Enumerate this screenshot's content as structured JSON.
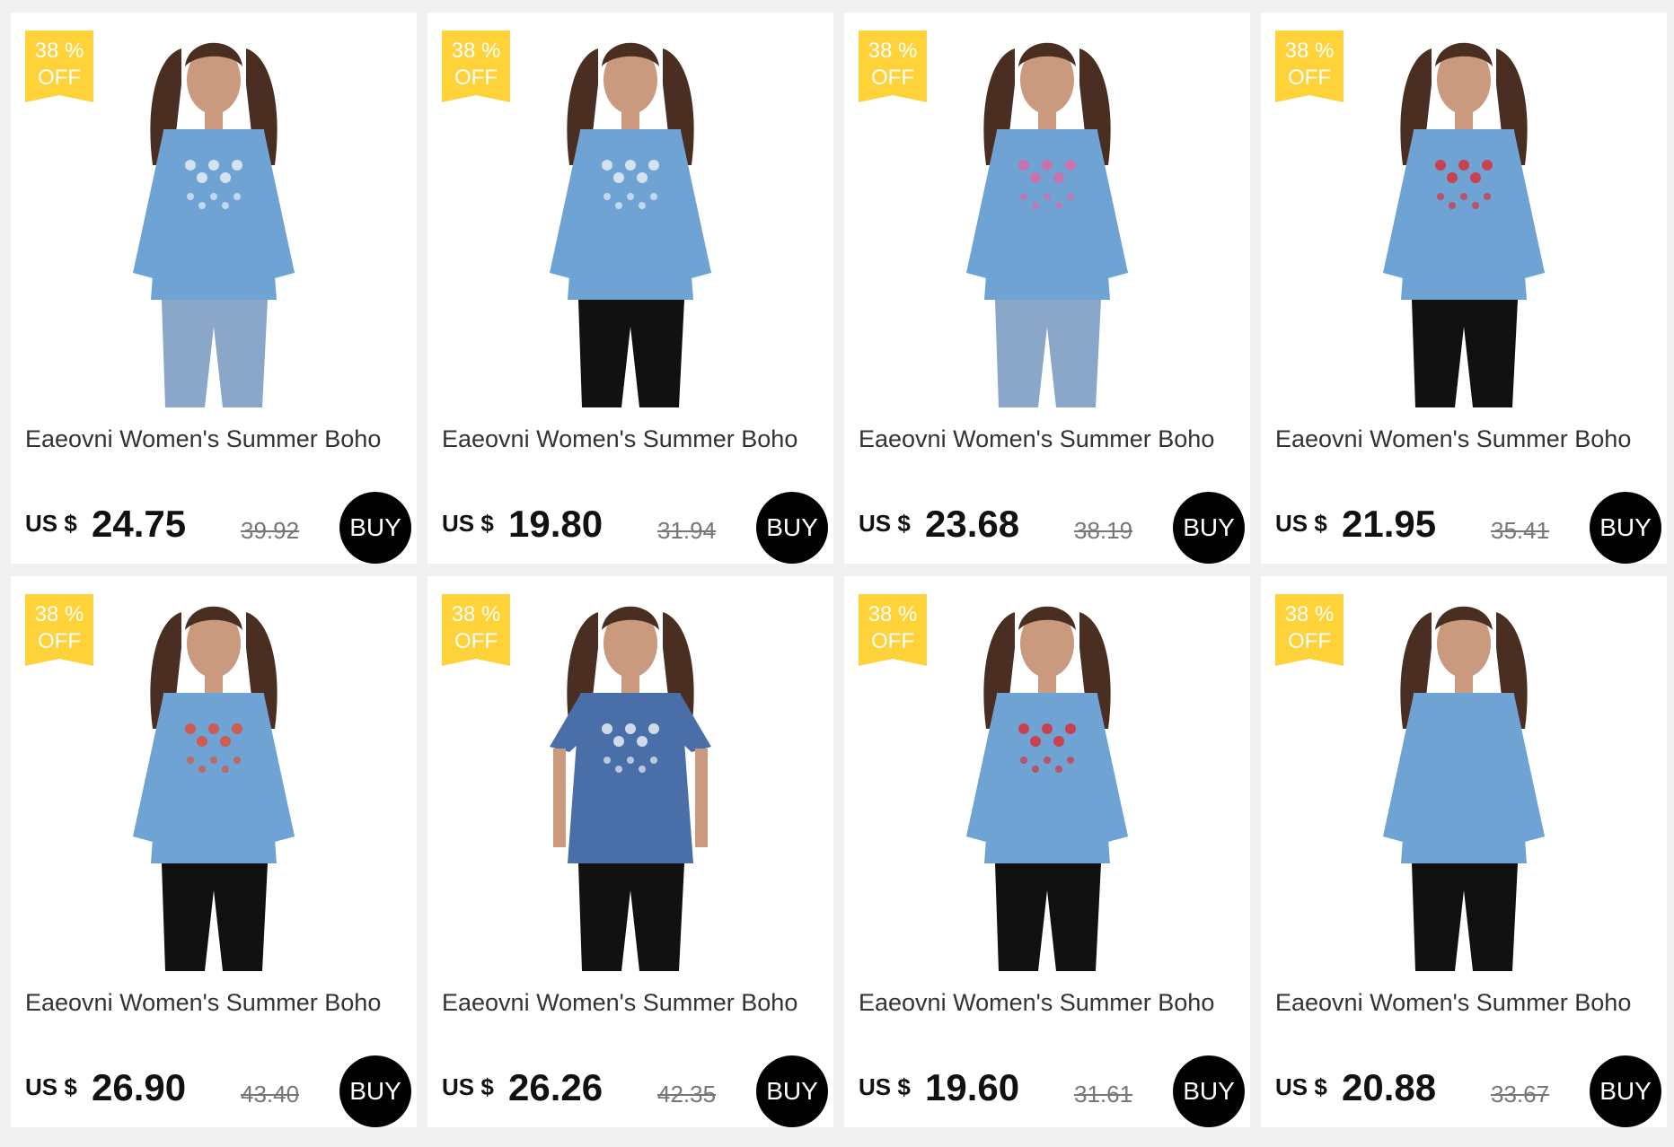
{
  "colors": {
    "badge": "#ffd23a",
    "buy_button": "#000000",
    "shirt_light": "#6fa3d4",
    "shirt_dark": "#4a6fa8",
    "pants_black": "#111111",
    "jeans": "#8aa6c8"
  },
  "products": [
    {
      "badge_pct": "38 %",
      "badge_off": "OFF",
      "title": "Eaeovni Women's Summer Boho",
      "currency": "US $",
      "price": "24.75",
      "old_price": "39.92",
      "buy": "BUY",
      "image": "model-denim-blouse-white-embroidery-jeans"
    },
    {
      "badge_pct": "38 %",
      "badge_off": "OFF",
      "title": "Eaeovni Women's Summer Boho",
      "currency": "US $",
      "price": "19.80",
      "old_price": "31.94",
      "buy": "BUY",
      "image": "model-denim-shirt-black-pants"
    },
    {
      "badge_pct": "38 %",
      "badge_off": "OFF",
      "title": "Eaeovni Women's Summer Boho",
      "currency": "US $",
      "price": "23.68",
      "old_price": "38.19",
      "buy": "BUY",
      "image": "model-denim-blouse-floral-embroidery-jeans"
    },
    {
      "badge_pct": "38 %",
      "badge_off": "OFF",
      "title": "Eaeovni Women's Summer Boho",
      "currency": "US $",
      "price": "21.95",
      "old_price": "35.41",
      "buy": "BUY",
      "image": "model-denim-blouse-embroidered-sleeves-black-pants"
    },
    {
      "badge_pct": "38 %",
      "badge_off": "OFF",
      "title": "Eaeovni Women's Summer Boho",
      "currency": "US $",
      "price": "26.90",
      "old_price": "43.40",
      "buy": "BUY",
      "image": "model-denim-top-colorful-embroidery-black-pants"
    },
    {
      "badge_pct": "38 %",
      "badge_off": "OFF",
      "title": "Eaeovni Women's Summer Boho",
      "currency": "US $",
      "price": "26.26",
      "old_price": "42.35",
      "buy": "BUY",
      "image": "model-dark-denim-tee-white-print-black-pants"
    },
    {
      "badge_pct": "38 %",
      "badge_off": "OFF",
      "title": "Eaeovni Women's Summer Boho",
      "currency": "US $",
      "price": "19.60",
      "old_price": "31.61",
      "buy": "BUY",
      "image": "model-denim-blouse-red-embroidery-black-pants"
    },
    {
      "badge_pct": "38 %",
      "badge_off": "OFF",
      "title": "Eaeovni Women's Summer Boho",
      "currency": "US $",
      "price": "20.88",
      "old_price": "33.67",
      "buy": "BUY",
      "image": "model-denim-blouse-plain-black-pants"
    }
  ]
}
